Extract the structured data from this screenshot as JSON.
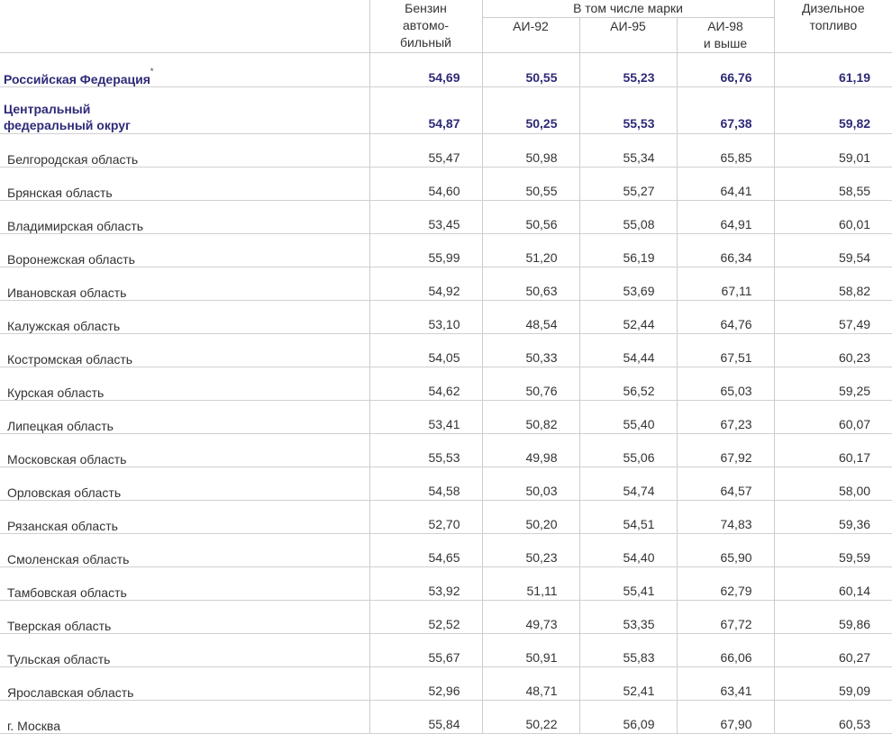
{
  "header": {
    "gasoline": [
      "Бензин",
      "автомо-",
      "бильный"
    ],
    "including_brands": "В том числе марки",
    "ai92": "АИ-92",
    "ai95": "АИ-95",
    "ai98": [
      "АИ-98",
      "и выше"
    ],
    "diesel": [
      "Дизельное",
      "топливо"
    ]
  },
  "federation": {
    "name": "Российская Федерация",
    "footnote_mark": "*",
    "values": [
      "54,69",
      "50,55",
      "55,23",
      "66,76",
      "61,19"
    ]
  },
  "district": {
    "name_lines": [
      "Центральный",
      "федеральный округ"
    ],
    "values": [
      "54,87",
      "50,25",
      "55,53",
      "67,38",
      "59,82"
    ]
  },
  "regions": [
    {
      "name": "Белгородская область",
      "values": [
        "55,47",
        "50,98",
        "55,34",
        "65,85",
        "59,01"
      ]
    },
    {
      "name": "Брянская область",
      "values": [
        "54,60",
        "50,55",
        "55,27",
        "64,41",
        "58,55"
      ]
    },
    {
      "name": "Владимирская область",
      "values": [
        "53,45",
        "50,56",
        "55,08",
        "64,91",
        "60,01"
      ]
    },
    {
      "name": "Воронежская область",
      "values": [
        "55,99",
        "51,20",
        "56,19",
        "66,34",
        "59,54"
      ]
    },
    {
      "name": "Ивановская область",
      "values": [
        "54,92",
        "50,63",
        "53,69",
        "67,11",
        "58,82"
      ]
    },
    {
      "name": "Калужская область",
      "values": [
        "53,10",
        "48,54",
        "52,44",
        "64,76",
        "57,49"
      ]
    },
    {
      "name": "Костромская область",
      "values": [
        "54,05",
        "50,33",
        "54,44",
        "67,51",
        "60,23"
      ]
    },
    {
      "name": "Курская область",
      "values": [
        "54,62",
        "50,76",
        "56,52",
        "65,03",
        "59,25"
      ]
    },
    {
      "name": "Липецкая область",
      "values": [
        "53,41",
        "50,82",
        "55,40",
        "67,23",
        "60,07"
      ]
    },
    {
      "name": "Московская область",
      "values": [
        "55,53",
        "49,98",
        "55,06",
        "67,92",
        "60,17"
      ]
    },
    {
      "name": "Орловская область",
      "values": [
        "54,58",
        "50,03",
        "54,74",
        "64,57",
        "58,00"
      ]
    },
    {
      "name": "Рязанская область",
      "values": [
        "52,70",
        "50,20",
        "54,51",
        "74,83",
        "59,36"
      ]
    },
    {
      "name": "Смоленская область",
      "values": [
        "54,65",
        "50,23",
        "54,40",
        "65,90",
        "59,59"
      ]
    },
    {
      "name": "Тамбовская область",
      "values": [
        "53,92",
        "51,11",
        "55,41",
        "62,79",
        "60,14"
      ]
    },
    {
      "name": "Тверская область",
      "values": [
        "52,52",
        "49,73",
        "53,35",
        "67,72",
        "59,86"
      ]
    },
    {
      "name": "Тульская область",
      "values": [
        "55,67",
        "50,91",
        "55,83",
        "66,06",
        "60,27"
      ]
    },
    {
      "name": "Ярославская область",
      "values": [
        "52,96",
        "48,71",
        "52,41",
        "63,41",
        "59,09"
      ]
    },
    {
      "name": "г. Москва",
      "values": [
        "55,84",
        "50,22",
        "56,09",
        "67,90",
        "60,53"
      ]
    }
  ]
}
